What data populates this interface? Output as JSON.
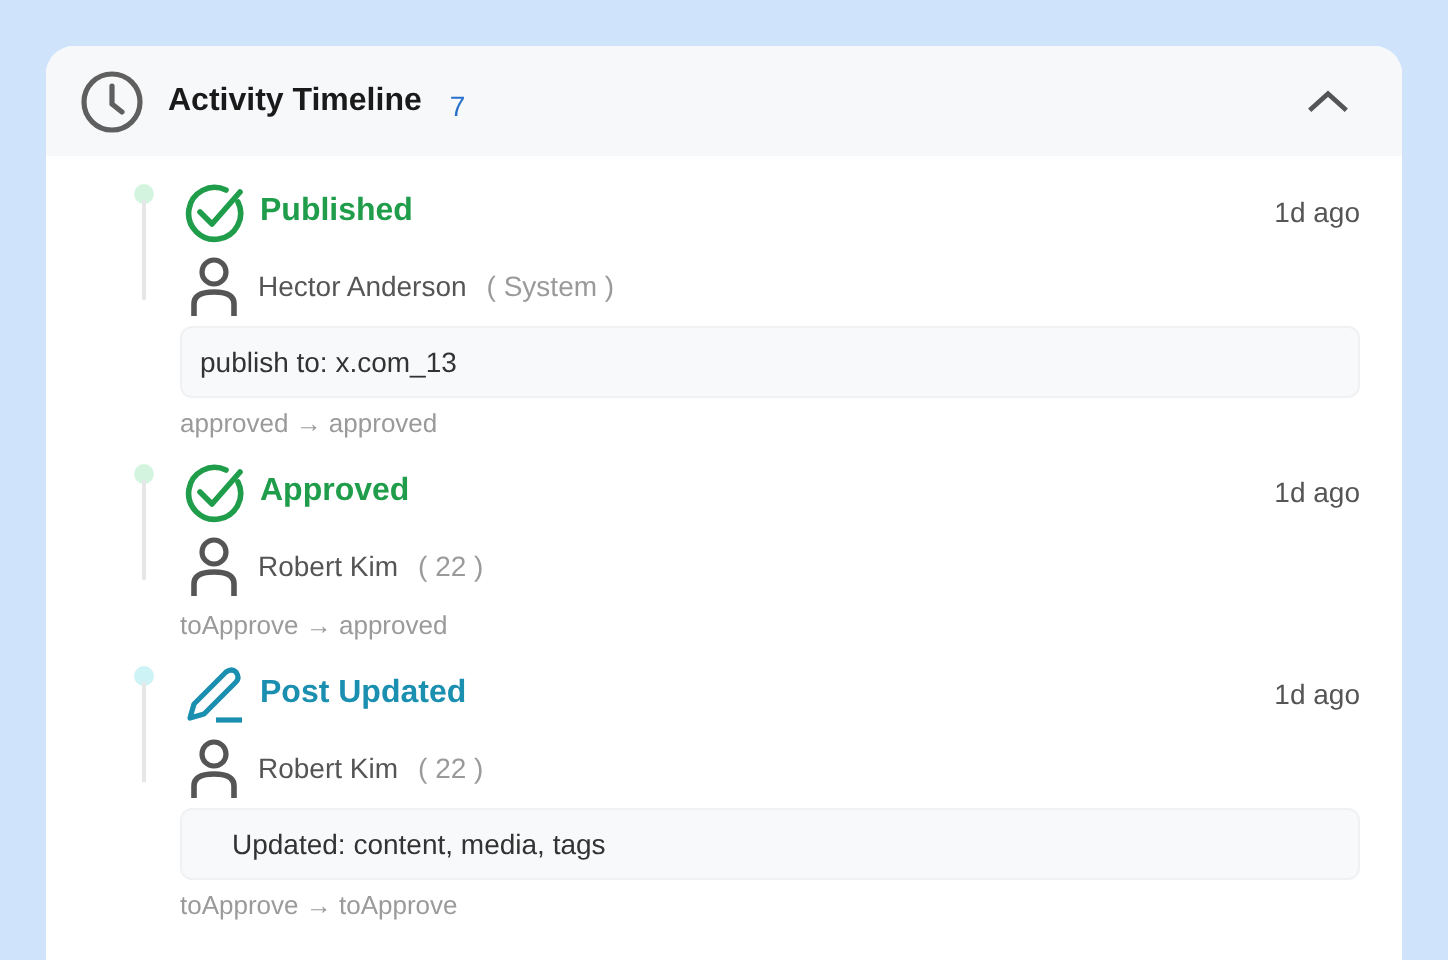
{
  "panel": {
    "title": "Activity Timeline",
    "count": "7",
    "expanded": true
  },
  "events": [
    {
      "kind": "published",
      "title": "Published",
      "time": "1d ago",
      "user": "Hector Anderson",
      "user_tag": "( System )",
      "note": "publish to: x.com_13",
      "transition": "approved → approved"
    },
    {
      "kind": "approved",
      "title": "Approved",
      "time": "1d ago",
      "user": "Robert Kim",
      "user_tag": "( 22 )",
      "transition": "toApprove → approved"
    },
    {
      "kind": "updated",
      "title": "Post Updated",
      "time": "1d ago",
      "user": "Robert Kim",
      "user_tag": "( 22 )",
      "changes": "Updated: content, media, tags",
      "transition": "toApprove → toApprove"
    }
  ]
}
